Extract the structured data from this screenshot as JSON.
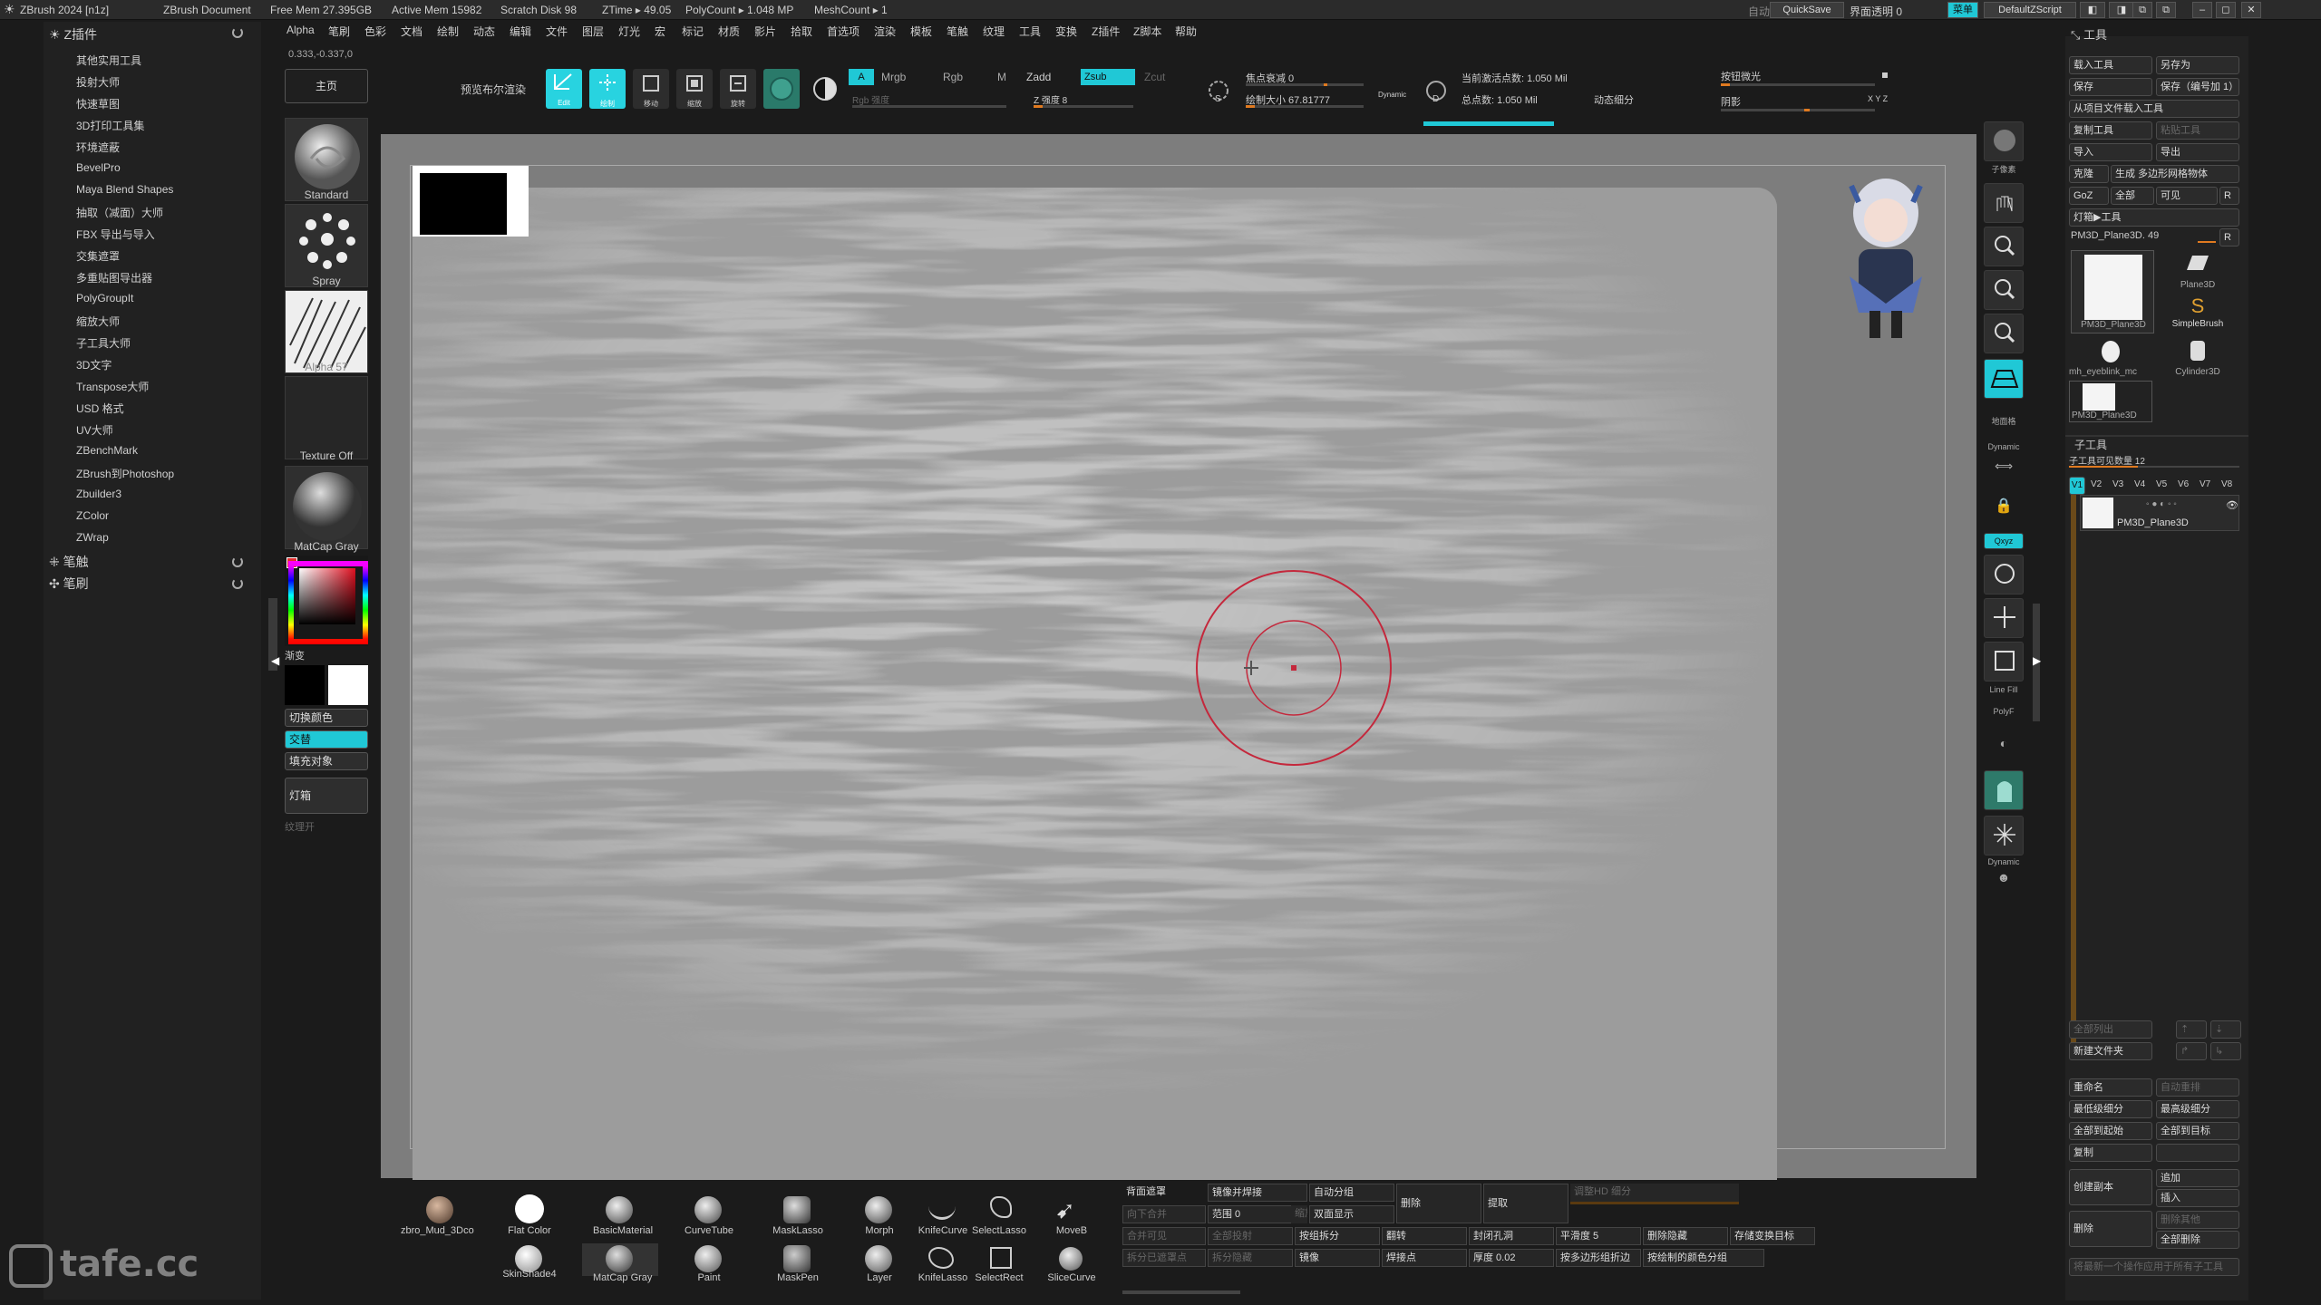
{
  "titlebar": {
    "app": "ZBrush 2024 [n1z]",
    "doc": "ZBrush Document",
    "free_mem": "Free Mem 27.395GB",
    "active_mem": "Active Mem 15982",
    "scratch": "Scratch Disk 98",
    "ztime": "ZTime ▸ 49.05",
    "polycount": "PolyCount ▸ 1.048 MP",
    "meshcount": "MeshCount ▸ 1",
    "auto": "自动",
    "quicksave": "QuickSave",
    "transparency": "界面透明 0",
    "menu": "菜单",
    "script": "DefaultZScript"
  },
  "menubar": [
    "Alpha",
    "笔刷",
    "色彩",
    "文档",
    "绘制",
    "动态",
    "编辑",
    "文件",
    "图层",
    "灯光",
    "宏",
    "标记",
    "材质",
    "影片",
    "拾取",
    "首选项",
    "渲染",
    "模板",
    "笔触",
    "纹理",
    "工具",
    "变换",
    "Z插件",
    "Z脚本",
    "帮助"
  ],
  "coords": "0.333,-0.337,0",
  "leftlist": {
    "zplugin": "Z插件",
    "items": [
      "其他实用工具",
      "投射大师",
      "快速草图",
      "3D打印工具集",
      "环境遮蔽",
      "BevelPro",
      "Maya Blend Shapes",
      "抽取（减面）大师",
      "FBX 导出与导入",
      "交集遮罩",
      "多重贴图导出器",
      "PolyGroupIt",
      "缩放大师",
      "子工具大师",
      "3D文字",
      "Transpose大师",
      "USD 格式",
      "UV大师",
      "ZBenchMark",
      "ZBrush到Photoshop",
      "Zbuilder3",
      "ZColor",
      "ZWrap"
    ],
    "stroke": "笔触",
    "brush": "笔刷"
  },
  "toolcol": {
    "home": "主页",
    "standard": "Standard",
    "spray": "Spray",
    "alpha": "Alpha 57",
    "texture": "Texture Off",
    "matcap": "MatCap Gray",
    "gradient": "渐变",
    "switch_color": "切换颜色",
    "alternate": "交替",
    "fill": "填充对象",
    "lightbox": "灯箱",
    "texture_map": "纹理开"
  },
  "shelf": {
    "bool_render": "预览布尔渲染",
    "edit": "Edit",
    "draw": "绘制",
    "move": "移动",
    "scale": "缩放",
    "rotate": "旋转",
    "a": "A",
    "mrgb": "Mrgb",
    "rgb": "Rgb",
    "m": "M",
    "zadd": "Zadd",
    "zsub": "Zsub",
    "zcut": "Zcut",
    "rgb_intensity": "Rgb 强度",
    "z_intensity": "Z 强度 8",
    "focal_shift": "焦点衰减 0",
    "draw_size": "绘制大小 67.81777",
    "dynamic": "Dynamic",
    "active_points": "当前激活点数: 1.050 Mil",
    "total_points": "总点数: 1.050 Mil",
    "dyn_subdiv": "动态细分",
    "smooth_light": "按钮微光",
    "shadow": "阴影",
    "xyz": "X Y Z"
  },
  "rightstrip": [
    "BPR",
    "子像素",
    "滚动",
    "Zoom2D",
    "100%",
    "AC50%",
    "透视",
    "地面格",
    "Dynamic",
    "对称",
    "锁定",
    "Qxyz",
    "旋转",
    "移动",
    "缩放",
    "Line Fill",
    "PolyF",
    "透明",
    "幽灵",
    "Xpose",
    "Dynamic",
    "孤立"
  ],
  "rightpanel": {
    "title": "工具",
    "load": "载入工具",
    "save_as": "另存为",
    "save": "保存",
    "save_inc": "保存（编号加 1）",
    "load_project": "从项目文件载入工具",
    "copy_tool": "复制工具",
    "paste_tool": "粘贴工具",
    "import": "导入",
    "export": "导出",
    "clone": "克隆",
    "make_polymesh": "生成 多边形网格物体",
    "goz": "GoZ",
    "all": "全部",
    "visible": "可见",
    "r": "R",
    "lightbox_tool": "灯箱▶工具",
    "current_tool": "PM3D_Plane3D. 49",
    "tools": [
      "PM3D_Plane3D",
      "Plane3D",
      "SimpleBrush",
      "mh_eyeblink_mc",
      "Cylinder3D",
      "PM3D_Plane3D"
    ],
    "subtool": "子工具",
    "visible_count": "子工具可见数量 12",
    "versions": [
      "V1",
      "V2",
      "V3",
      "V4",
      "V5",
      "V6",
      "V7",
      "V8"
    ],
    "subtool_name": "PM3D_Plane3D",
    "list_all": "全部列出",
    "new_folder": "新建文件夹",
    "rename": "重命名",
    "auto_reorder": "自动重排",
    "lowest_sub": "最低级细分",
    "highest_sub": "最高级细分",
    "all_to_start": "全部到起始",
    "all_to_target": "全部到目标",
    "duplicate": "复制",
    "append": "追加",
    "create_copy": "创建副本",
    "insert": "插入",
    "delete": "删除",
    "delete_other": "删除其他",
    "delete_all": "全部删除",
    "hint": "将最新一个操作应用于所有子工具"
  },
  "bottombar": {
    "brushes_top": [
      "zbro_Mud_3Dco",
      "Flat Color",
      "BasicMaterial",
      "CurveTube",
      "MaskLasso",
      "Morph",
      "KnifeCurve",
      "SelectLasso",
      "MoveB"
    ],
    "brushes_bottom": [
      "SkinShade4",
      "MatCap Gray",
      "Paint",
      "MaskPen",
      "Layer",
      "KnifeLasso",
      "SelectRect",
      "SliceCurve"
    ],
    "buttons": {
      "backface_mask": "背面遮罩",
      "mirror_weld": "镜像并焊接",
      "auto_group": "自动分组",
      "delete_lbl": "删除",
      "extract": "提取",
      "smooth_hd": "调整HD 细分",
      "range": "范围 0",
      "double_display": "双面显示",
      "down_merge": "向下合并",
      "scale_lbl": "缩放",
      "merge_visible": "合并可见",
      "all_project": "全部投射",
      "split_groups": "按组拆分",
      "flip": "翻转",
      "close_holes": "封闭孔洞",
      "smooth5": "平滑度 5",
      "delete_hidden": "删除隐藏",
      "store_morph": "存储变换目标",
      "split_hidden": "拆分已遮罩点",
      "split_unmasked": "拆分隐藏",
      "mirror": "镜像",
      "weld": "焊接点",
      "thickness": "厚度 0.02",
      "poly_panel": "按多边形组折边",
      "polypaint_groups": "按绘制的颜色分组"
    }
  },
  "watermark": "tafe.cc"
}
